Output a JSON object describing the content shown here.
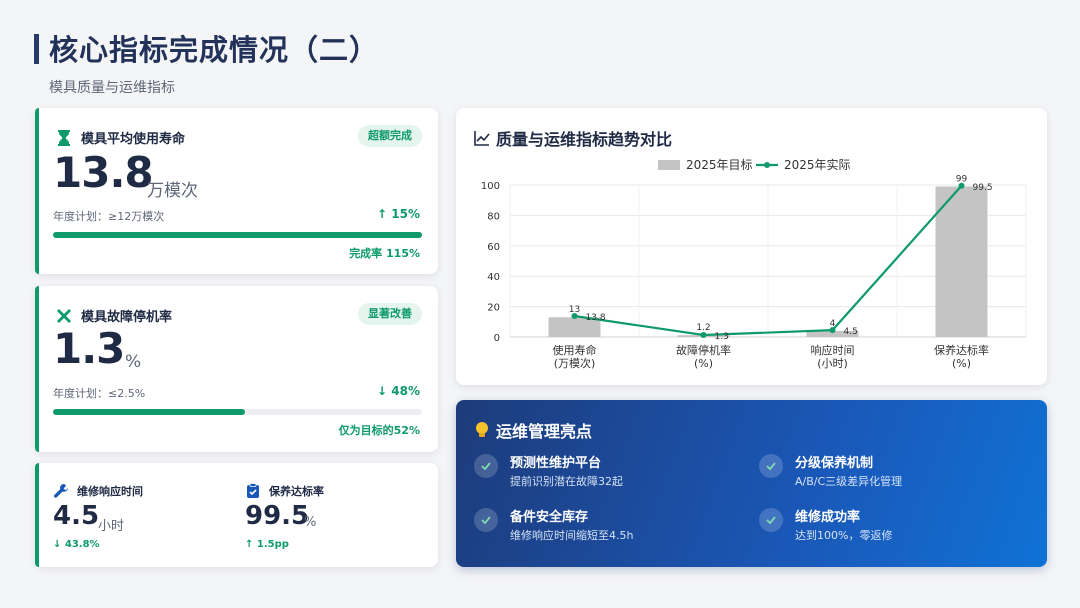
{
  "header": {
    "title": "核心指标完成情况（二）",
    "subtitle": "模具质量与运维指标"
  },
  "metrics": [
    {
      "label": "模具平均使用寿命",
      "icon": "hourglass-icon",
      "badge": "超额完成",
      "value": "13.8",
      "unit": "万模次",
      "plan": "年度计划：≥12万模次",
      "delta": "↑ 15%",
      "progress_percent": 100,
      "tag": "完成率 115%"
    },
    {
      "label": "模具故障停机率",
      "icon": "tools-icon",
      "badge": "显著改善",
      "value": "1.3",
      "unit": "%",
      "plan": "年度计划：≤2.5%",
      "delta": "↓ 48%",
      "progress_percent": 52,
      "tag": "仅为目标的52%"
    }
  ],
  "mini_metrics": [
    {
      "label": "维修响应时间",
      "icon": "wrench-icon",
      "value": "4.5",
      "unit": "小时",
      "delta": "↓ 43.8%"
    },
    {
      "label": "保养达标率",
      "icon": "clipboard-check-icon",
      "value": "99.5",
      "unit": "%",
      "delta": "↑ 1.5pp"
    }
  ],
  "chart_title": "质量与运维指标趋势对比",
  "chart_data": {
    "type": "bar",
    "title": "质量与运维指标趋势对比",
    "categories": [
      [
        "使用寿命",
        "(万模次)"
      ],
      [
        "故障停机率",
        "(%)"
      ],
      [
        "响应时间",
        "(小时)"
      ],
      [
        "保养达标率",
        "(%)"
      ]
    ],
    "series": [
      {
        "name": "2025年目标",
        "type": "bar",
        "values": [
          13,
          1.2,
          4,
          99
        ],
        "labels": [
          "13",
          "1.2",
          "4",
          "99"
        ],
        "color": "#c4c4c4"
      },
      {
        "name": "2025年实际",
        "type": "line",
        "values": [
          13.8,
          1.3,
          4.5,
          99.5
        ],
        "labels": [
          "13.8",
          "1.3",
          "4.5",
          "99.5"
        ],
        "color": "#0f9a6b"
      }
    ],
    "ylim": [
      0,
      100
    ],
    "yticks": [
      0,
      20,
      40,
      60,
      80,
      100
    ],
    "grid": true,
    "legend": "top"
  },
  "highlights": {
    "title": "运维管理亮点",
    "items": [
      {
        "title": "预测性维护平台",
        "desc": "提前识别潜在故障32起"
      },
      {
        "title": "分级保养机制",
        "desc": "A/B/C三级差异化管理"
      },
      {
        "title": "备件安全库存",
        "desc": "维修响应时间缩短至4.5h"
      },
      {
        "title": "维修成功率",
        "desc": "达到100%，零返修"
      }
    ]
  },
  "colors": {
    "accent_green": "#0f9a6b",
    "navy": "#1f2a44",
    "bar_gray": "#c4c4c4",
    "highlight_blue": "#1a58b8"
  }
}
